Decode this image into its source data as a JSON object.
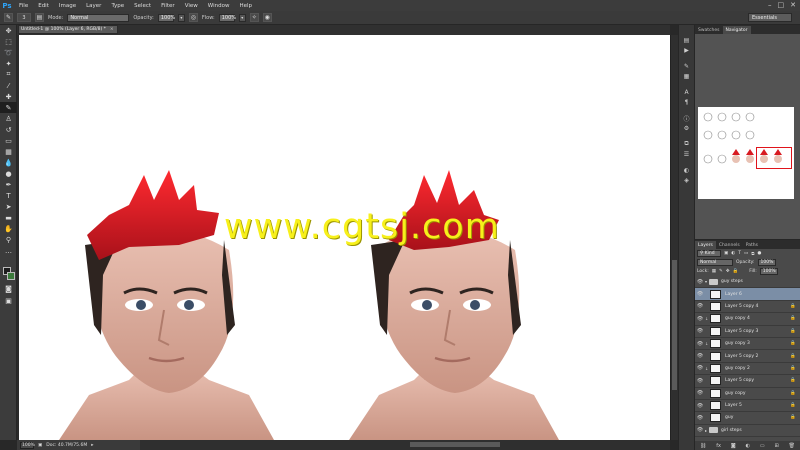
{
  "app": {
    "logo": "Ps"
  },
  "menu": [
    "File",
    "Edit",
    "Image",
    "Layer",
    "Type",
    "Select",
    "Filter",
    "View",
    "Window",
    "Help"
  ],
  "window_buttons": [
    "–",
    "□",
    "✕"
  ],
  "options": {
    "brush_size": "3",
    "mode_label": "Mode:",
    "mode_value": "Normal",
    "opacity_label": "Opacity:",
    "opacity_value": "100%",
    "flow_label": "Flow:",
    "flow_value": "100%",
    "workspace": "Essentials"
  },
  "document": {
    "tab_title": "Untitled-1 @ 100% (Layer 6, RGB/8) *",
    "zoom": "100%",
    "doc_info": "Doc: 40.7M/75.6M"
  },
  "watermark": "www.cgtsj.com",
  "panels": {
    "top_tabs": [
      "Swatches",
      "Navigator"
    ],
    "nav_zoom": "100%",
    "layer_tabs": [
      "Layers",
      "Channels",
      "Paths"
    ],
    "kind_label": "Kind",
    "blend_mode": "Normal",
    "opacity_label": "Opacity:",
    "opacity_value": "100%",
    "lock_label": "Lock:",
    "fill_label": "Fill:",
    "fill_value": "100%"
  },
  "layers": [
    {
      "name": "guy steps",
      "type": "group-open"
    },
    {
      "name": "Layer 6",
      "type": "layer",
      "selected": true
    },
    {
      "name": "Layer 5 copy 4",
      "type": "layer",
      "locked": true
    },
    {
      "name": "guy copy 4",
      "type": "layer",
      "clipped": true,
      "locked": true
    },
    {
      "name": "Layer 5 copy 3",
      "type": "layer",
      "locked": true
    },
    {
      "name": "guy copy 3",
      "type": "layer",
      "clipped": true,
      "locked": true
    },
    {
      "name": "Layer 5 copy 2",
      "type": "layer",
      "locked": true
    },
    {
      "name": "guy copy 2",
      "type": "layer",
      "clipped": true,
      "locked": true
    },
    {
      "name": "Layer 5 copy",
      "type": "layer",
      "locked": true
    },
    {
      "name": "guy copy",
      "type": "layer",
      "locked": true
    },
    {
      "name": "Layer 5",
      "type": "layer",
      "locked": true
    },
    {
      "name": "guy",
      "type": "layer",
      "locked": true
    },
    {
      "name": "girl steps",
      "type": "group-closed"
    }
  ],
  "colors": {
    "hair_red": "#d81b22",
    "watermark_yellow": "#f7f01b",
    "selection_blue": "#7b8ea6"
  }
}
